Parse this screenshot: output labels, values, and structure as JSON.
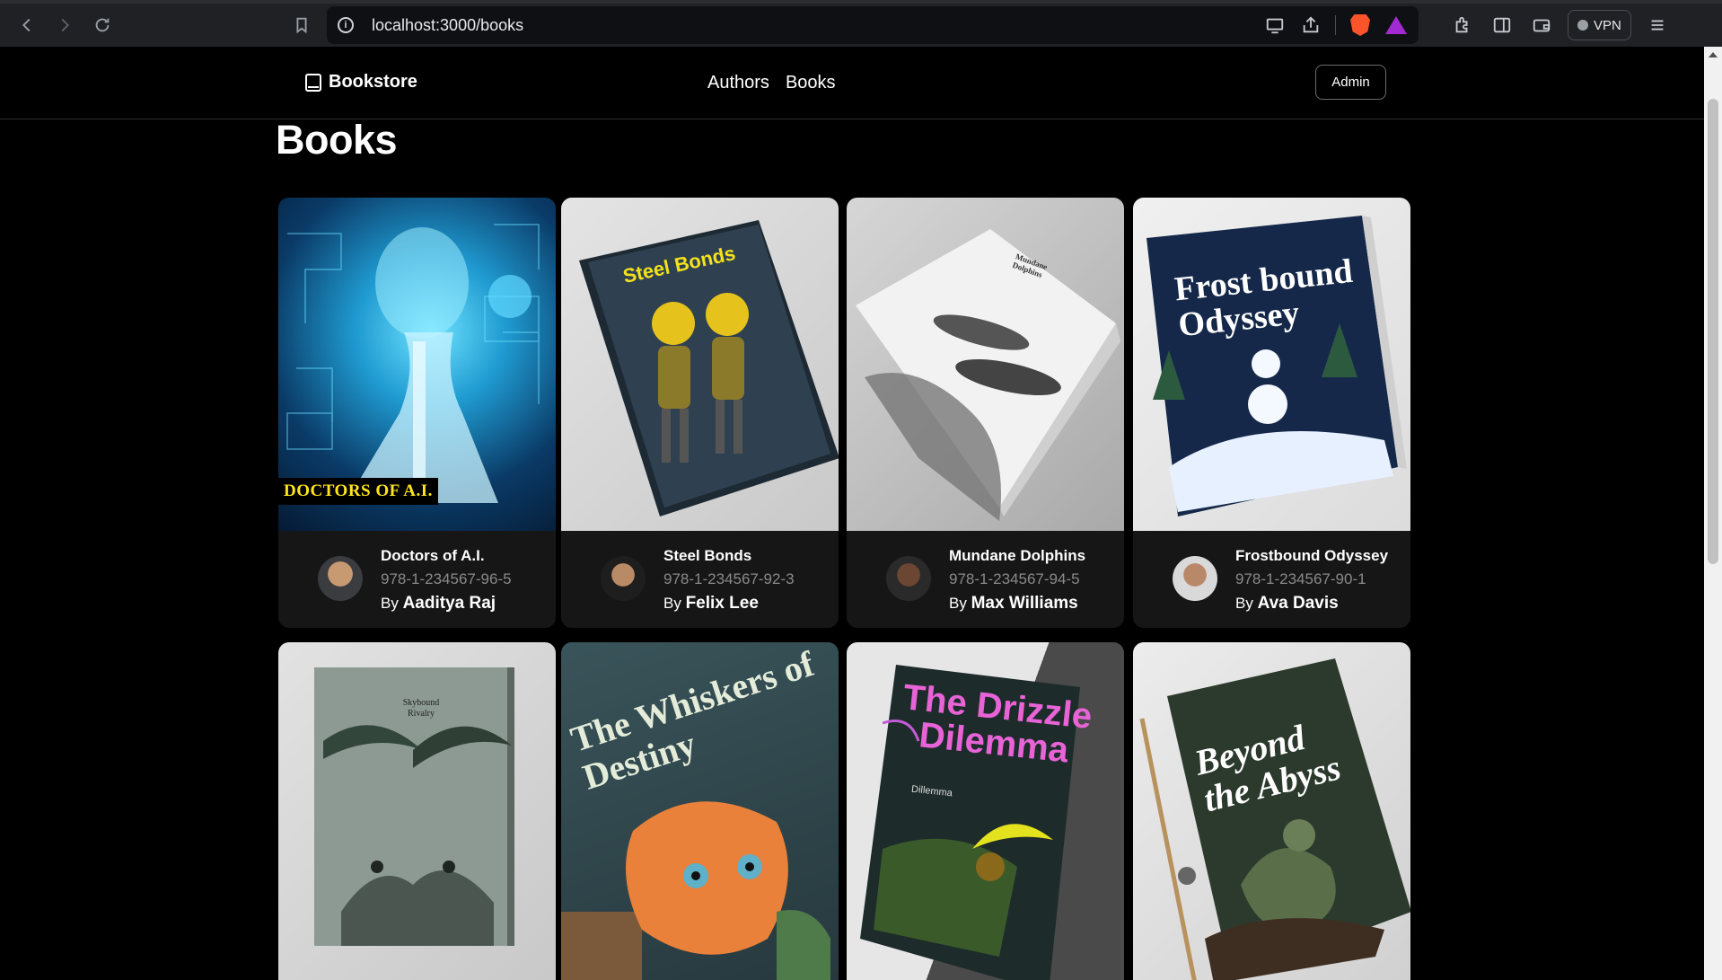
{
  "browser": {
    "url": "localhost:3000/books",
    "vpn_label": "VPN"
  },
  "site": {
    "brand": "Bookstore",
    "nav": [
      "Authors",
      "Books"
    ],
    "admin_label": "Admin",
    "page_title": "Books"
  },
  "books": [
    {
      "title": "Doctors of A.I.",
      "isbn": "978-1-234567-96-5",
      "by": "By",
      "author": "Aaditya Raj",
      "cover_text": "DOCTORS OF A.I."
    },
    {
      "title": "Steel Bonds",
      "isbn": "978-1-234567-92-3",
      "by": "By",
      "author": "Felix Lee",
      "cover_text": "Steel Bonds"
    },
    {
      "title": "Mundane Dolphins",
      "isbn": "978-1-234567-94-5",
      "by": "By",
      "author": "Max Williams",
      "cover_text": "Mundane Dolphins"
    },
    {
      "title": "Frostbound Odyssey",
      "isbn": "978-1-234567-90-1",
      "by": "By",
      "author": "Ava Davis",
      "cover_text": "Frost bound Odyssey"
    },
    {
      "cover_text": "Skybound Rivalry"
    },
    {
      "cover_text": "The Whiskers of Destiny"
    },
    {
      "cover_text": "The Drizzle Dilemma",
      "cover_sub": "Dillemma"
    },
    {
      "cover_text": "Beyond the Abyss"
    }
  ]
}
